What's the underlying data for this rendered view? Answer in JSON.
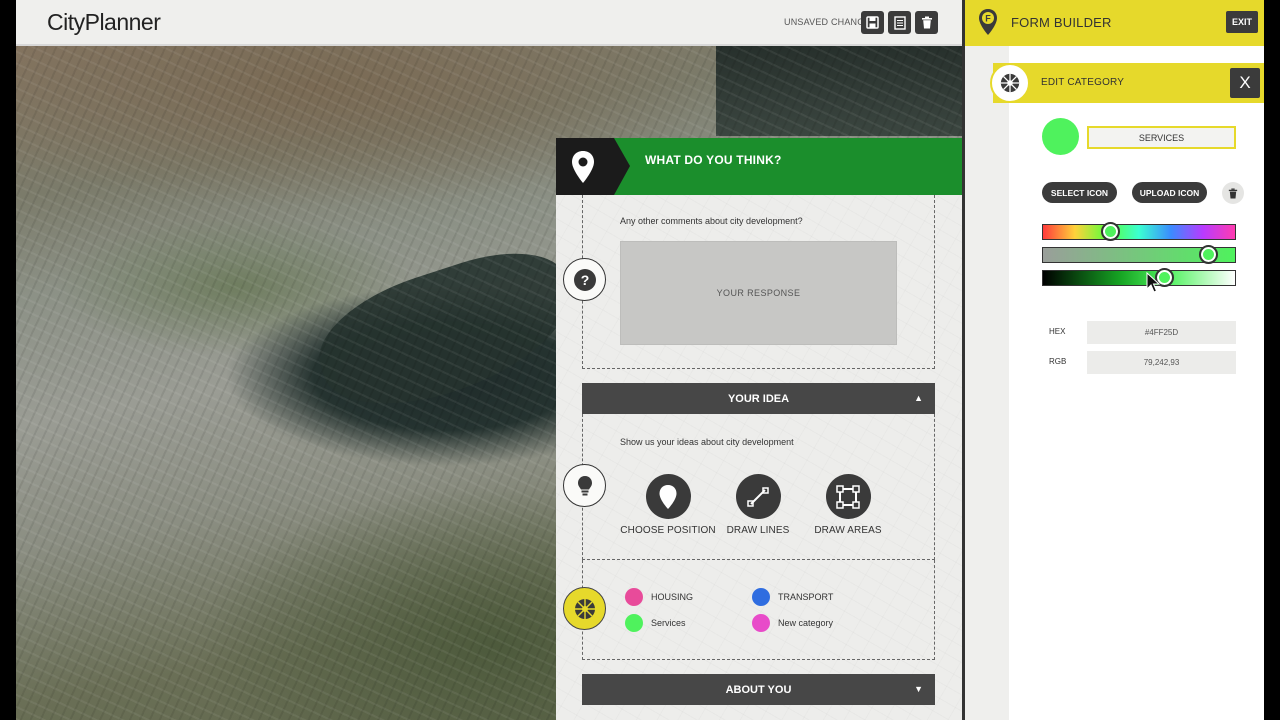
{
  "app": {
    "logo": "CityPlanner"
  },
  "toolbar": {
    "status": "UNSAVED CHANGES"
  },
  "survey": {
    "title": "WHAT DO YOU THINK?",
    "question": "Any other comments about city development?",
    "response_placeholder": "YOUR RESPONSE",
    "sections": [
      {
        "label": "YOUR IDEA",
        "arrow": "▲"
      },
      {
        "label": "ABOUT YOU",
        "arrow": "▼"
      }
    ],
    "idea_prompt": "Show us your ideas about city development",
    "tools": [
      {
        "label": "CHOOSE POSITION"
      },
      {
        "label": "DRAW LINES"
      },
      {
        "label": "DRAW AREAS"
      }
    ],
    "categories": [
      {
        "label": "HOUSING",
        "color": "#e84b9a"
      },
      {
        "label": "TRANSPORT",
        "color": "#2f6de0"
      },
      {
        "label": "Services",
        "color": "#4ff25d"
      },
      {
        "label": "New category",
        "color": "#e84bc9"
      }
    ]
  },
  "form_builder": {
    "title": "FORM BUILDER",
    "exit_label": "EXIT",
    "edit_category": {
      "title": "EDIT CATEGORY",
      "close_label": "X",
      "name_value": "SERVICES",
      "color": "#4ff25d",
      "select_icon_label": "SELECT ICON",
      "upload_icon_label": "UPLOAD ICON",
      "sliders": {
        "hue": 0.35,
        "saturation": 0.86,
        "lightness": 0.63
      },
      "hex_label": "HEX",
      "hex_value": "#4FF25D",
      "rgb_label": "RGB",
      "rgb_value": "79,242,93"
    }
  }
}
